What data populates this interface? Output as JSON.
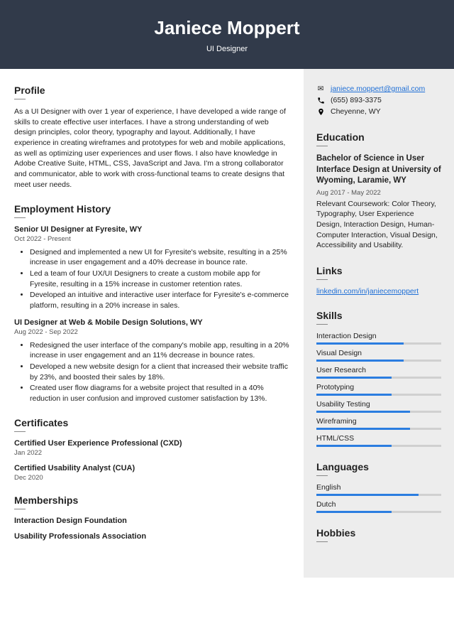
{
  "header": {
    "name": "Janiece Moppert",
    "title": "UI Designer"
  },
  "profile": {
    "heading": "Profile",
    "text": "As a UI Designer with over 1 year of experience, I have developed a wide range of skills to create effective user interfaces. I have a strong understanding of web design principles, color theory, typography and layout. Additionally, I have experience in creating wireframes and prototypes for web and mobile applications, as well as optimizing user experiences and user flows. I also have knowledge in Adobe Creative Suite, HTML, CSS, JavaScript and Java. I'm a strong collaborator and communicator, able to work with cross-functional teams to create designs that meet user needs."
  },
  "employment": {
    "heading": "Employment History",
    "jobs": [
      {
        "title": "Senior UI Designer at Fyresite, WY",
        "dates": "Oct 2022 - Present",
        "bullets": [
          "Designed and implemented a new UI for Fyresite's website, resulting in a 25% increase in user engagement and a 40% decrease in bounce rate.",
          "Led a team of four UX/UI Designers to create a custom mobile app for Fyresite, resulting in a 15% increase in customer retention rates.",
          "Developed an intuitive and interactive user interface for Fyresite's e-commerce platform, resulting in a 20% increase in sales."
        ]
      },
      {
        "title": "UI Designer at Web & Mobile Design Solutions, WY",
        "dates": "Aug 2022 - Sep 2022",
        "bullets": [
          "Redesigned the user interface of the company's mobile app, resulting in a 20% increase in user engagement and an 11% decrease in bounce rates.",
          "Developed a new website design for a client that increased their website traffic by 23%, and boosted their sales by 18%.",
          "Created user flow diagrams for a website project that resulted in a 40% reduction in user confusion and improved customer satisfaction by 13%."
        ]
      }
    ]
  },
  "certificates": {
    "heading": "Certificates",
    "items": [
      {
        "title": "Certified User Experience Professional (CXD)",
        "date": "Jan 2022"
      },
      {
        "title": "Certified Usability Analyst (CUA)",
        "date": "Dec 2020"
      }
    ]
  },
  "memberships": {
    "heading": "Memberships",
    "items": [
      "Interaction Design Foundation",
      "Usability Professionals Association"
    ]
  },
  "contact": {
    "email": "janiece.moppert@gmail.com",
    "phone": "(655) 893-3375",
    "location": "Cheyenne, WY"
  },
  "education": {
    "heading": "Education",
    "degree": "Bachelor of Science in User Interface Design at University of Wyoming, Laramie, WY",
    "dates": "Aug 2017 - May 2022",
    "desc": "Relevant Coursework: Color Theory, Typography, User Experience Design, Interaction Design, Human-Computer Interaction, Visual Design, Accessibility and Usability."
  },
  "links": {
    "heading": "Links",
    "items": [
      "linkedin.com/in/janiecemoppert"
    ]
  },
  "skills": {
    "heading": "Skills",
    "items": [
      {
        "name": "Interaction Design",
        "level": 70
      },
      {
        "name": "Visual Design",
        "level": 70
      },
      {
        "name": "User Research",
        "level": 60
      },
      {
        "name": "Prototyping",
        "level": 60
      },
      {
        "name": "Usability Testing",
        "level": 75
      },
      {
        "name": "Wireframing",
        "level": 75
      },
      {
        "name": "HTML/CSS",
        "level": 60
      }
    ]
  },
  "languages": {
    "heading": "Languages",
    "items": [
      {
        "name": "English",
        "level": 82
      },
      {
        "name": "Dutch",
        "level": 60
      }
    ]
  },
  "hobbies": {
    "heading": "Hobbies"
  }
}
